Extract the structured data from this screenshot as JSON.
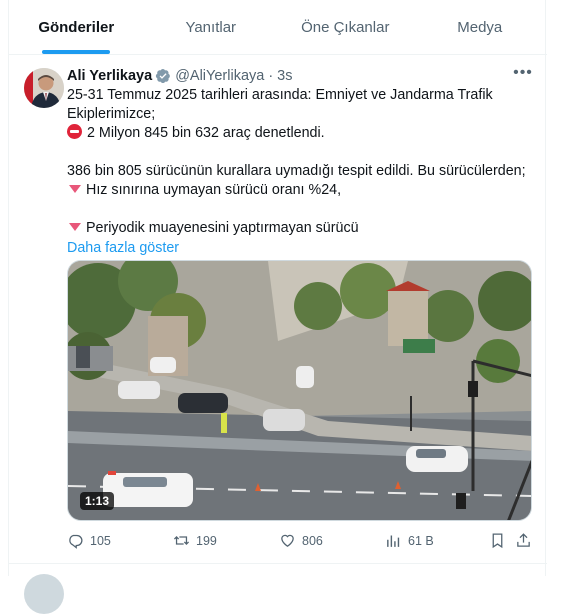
{
  "tabs": [
    {
      "label": "Gönderiler",
      "active": true
    },
    {
      "label": "Yanıtlar",
      "active": false
    },
    {
      "label": "Öne Çıkanlar",
      "active": false
    },
    {
      "label": "Medya",
      "active": false
    }
  ],
  "tweet": {
    "author_name": "Ali Yerlikaya",
    "verified_icon": "verified-badge-icon",
    "handle": "@AliYerlikaya",
    "separator": "·",
    "time": "3s",
    "lines": [
      "25-31 Temmuz 2025 tarihleri arasında: Emniyet ve Jandarma Trafik Ekiplerimizce;",
      "2 Milyon 845 bin 632 araç denetlendi.",
      "386 bin 805 sürücünün kurallara uymadığı tespit edildi. Bu sürücülerden;",
      "Hız sınırına uymayan sürücü oranı %24,",
      "Periyodik muayenesini yaptırmayan sürücü"
    ],
    "show_more": "Daha fazla göster",
    "video_duration": "1:13",
    "stats": {
      "replies": "105",
      "reposts": "199",
      "likes": "806",
      "views": "61 B"
    }
  },
  "colors": {
    "accent": "#1d9bf0",
    "muted": "#536471",
    "text": "#0f1419"
  }
}
